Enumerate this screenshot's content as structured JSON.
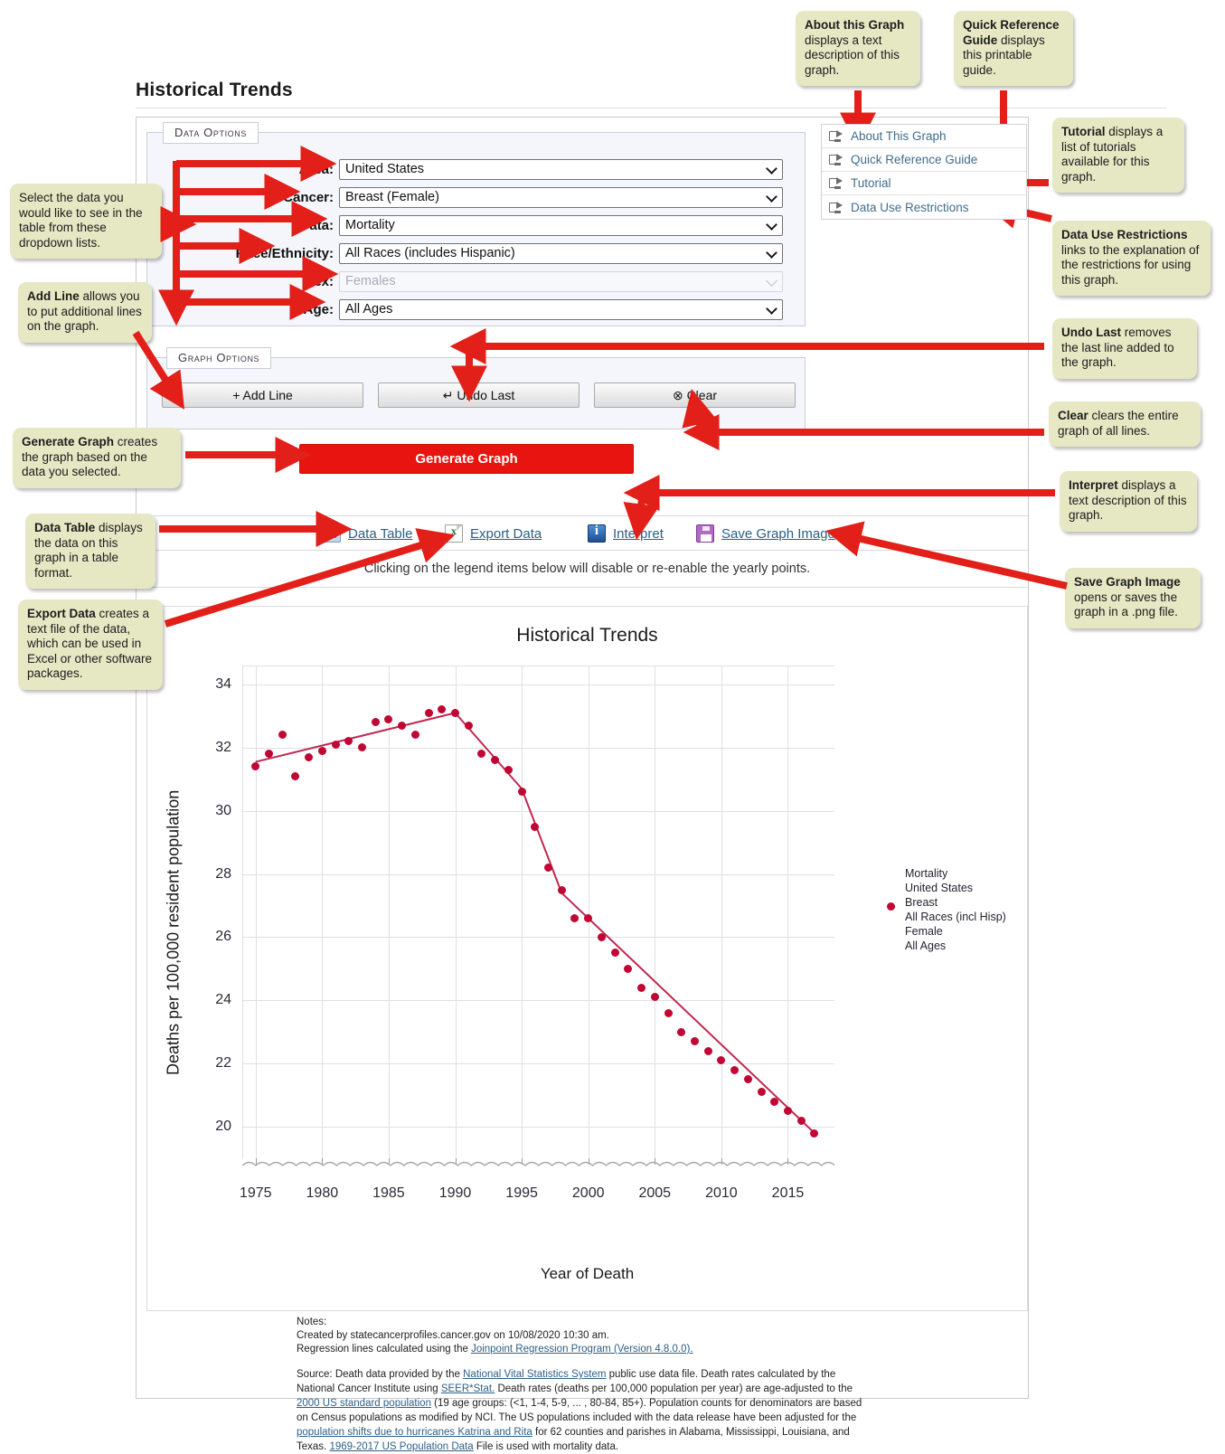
{
  "page": {
    "title": "Historical Trends"
  },
  "data_options": {
    "legend": "Data Options",
    "fields": [
      {
        "label": "Area:",
        "value": "United States",
        "name": "area",
        "disabled": false
      },
      {
        "label": "Cancer:",
        "value": "Breast (Female)",
        "name": "cancer",
        "disabled": false
      },
      {
        "label": "Data:",
        "value": "Mortality",
        "name": "data",
        "disabled": false
      },
      {
        "label": "Race/Ethnicity:",
        "value": "All Races (includes Hispanic)",
        "name": "race",
        "disabled": false
      },
      {
        "label": "Sex:",
        "value": "Females",
        "name": "sex",
        "disabled": true
      },
      {
        "label": "Age:",
        "value": "All Ages",
        "name": "age",
        "disabled": false
      }
    ]
  },
  "graph_options": {
    "legend": "Graph Options",
    "add_line": "+ Add Line",
    "undo_last": "↵ Undo Last",
    "clear": "⊗ Clear",
    "generate": "Generate Graph"
  },
  "side_links": [
    {
      "label": "About This Graph",
      "icon": "external-link-icon"
    },
    {
      "label": "Quick Reference Guide",
      "icon": "external-link-icon"
    },
    {
      "label": "Tutorial",
      "icon": "external-link-icon"
    },
    {
      "label": "Data Use Restrictions",
      "icon": "external-link-icon"
    }
  ],
  "toolbar": {
    "data_table": "Data Table",
    "export_data": "Export Data",
    "interpret": "Interpret",
    "save_graph_image": "Save Graph Image",
    "icons": [
      "data-table-icon",
      "excel-export-icon",
      "info-icon",
      "floppy-save-icon"
    ]
  },
  "hint": "Clicking on the legend items below will disable or re-enable the yearly points.",
  "legend": {
    "lines": [
      "Mortality",
      "United States",
      "Breast",
      "All Races (incl Hisp)",
      "Female",
      "All Ages"
    ]
  },
  "notes": {
    "heading": "Notes:",
    "created": "Created by statecancerprofiles.cancer.gov on 10/08/2020 10:30 am.",
    "regression_pre": "Regression lines calculated using the ",
    "regression_link": "Joinpoint Regression Program (Version 4.8.0.0).",
    "source_parts": [
      {
        "t": "Source: Death data provided by the ",
        "link": false
      },
      {
        "t": "National Vital Statistics System",
        "link": true
      },
      {
        "t": " public use data file. Death rates calculated by the National Cancer Institute using ",
        "link": false
      },
      {
        "t": "SEER*Stat.",
        "link": true
      },
      {
        "t": " Death rates (deaths per 100,000 population per year) are age-adjusted to the ",
        "link": false
      },
      {
        "t": "2000 US standard population",
        "link": true
      },
      {
        "t": " (19 age groups: (<1, 1-4, 5-9, ... , 80-84, 85+). Population counts for denominators are based on Census populations as modified by NCI. The US populations included with the data release have been adjusted for the ",
        "link": false
      },
      {
        "t": "population shifts due to hurricanes Katrina and Rita",
        "link": true
      },
      {
        "t": " for 62 counties and parishes in Alabama, Mississippi, Louisiana, and Texas. ",
        "link": false
      },
      {
        "t": "1969-2017 US Population Data",
        "link": true
      },
      {
        "t": " File is used with mortality data.",
        "link": false
      }
    ]
  },
  "callouts": [
    {
      "id": "about-this-graph",
      "bold": "About this Graph",
      "rest": " displays a text description of this graph."
    },
    {
      "id": "quick-reference",
      "bold": "Quick Reference Guide",
      "rest": " displays this printable guide."
    },
    {
      "id": "tutorial",
      "bold": "Tutorial",
      "rest": " displays a list of tutorials available for this graph."
    },
    {
      "id": "data-use",
      "bold": "Data Use Restrictions",
      "rest": " links to the explanation of the restrictions for using this graph."
    },
    {
      "id": "select-data",
      "bold": "",
      "rest": "Select the data you would like to see in the table from these dropdown lists."
    },
    {
      "id": "add-line",
      "bold": "Add Line",
      "rest": " allows you to put additional lines on the graph."
    },
    {
      "id": "generate-graph",
      "bold": "Generate Graph",
      "rest": " creates the graph based on the data you selected."
    },
    {
      "id": "data-table",
      "bold": "Data Table",
      "rest": " displays the data on this graph in a table format."
    },
    {
      "id": "export-data",
      "bold": "Export Data",
      "rest": " creates a text file of the data, which can be used in Excel or other software packages."
    },
    {
      "id": "undo-last",
      "bold": "Undo Last",
      "rest": " removes the last line added to the graph."
    },
    {
      "id": "clear",
      "bold": "Clear",
      "rest": " clears the entire graph of all lines."
    },
    {
      "id": "interpret",
      "bold": "Interpret",
      "rest": " displays a text description of this graph."
    },
    {
      "id": "save-graph-image",
      "bold": "Save Graph Image",
      "rest": " opens or saves the graph in a .png file."
    }
  ],
  "chart_data": {
    "type": "scatter",
    "title": "Historical Trends",
    "xlabel": "Year of Death",
    "ylabel": "Deaths per 100,000 resident population",
    "xlim": [
      1974,
      2018.5
    ],
    "ylim": [
      19.0,
      34.6
    ],
    "xticks": [
      1975,
      1980,
      1985,
      1990,
      1995,
      2000,
      2005,
      2010,
      2015
    ],
    "yticks": [
      20,
      22,
      24,
      26,
      28,
      30,
      32,
      34
    ],
    "grid": true,
    "legend_position": "right",
    "point_color": "#c00733",
    "line_color": "#c0294f",
    "series": [
      {
        "name": "Mortality, United States, Breast, All Races (incl Hisp), Female, All Ages",
        "x": [
          1975,
          1976,
          1977,
          1978,
          1979,
          1980,
          1981,
          1982,
          1983,
          1984,
          1985,
          1986,
          1987,
          1988,
          1989,
          1990,
          1991,
          1992,
          1993,
          1994,
          1995,
          1996,
          1997,
          1998,
          1999,
          2000,
          2001,
          2002,
          2003,
          2004,
          2005,
          2006,
          2007,
          2008,
          2009,
          2010,
          2011,
          2012,
          2013,
          2014,
          2015,
          2016,
          2017
        ],
        "values": [
          31.4,
          31.8,
          32.4,
          31.1,
          31.7,
          31.9,
          32.1,
          32.2,
          32.0,
          32.8,
          32.9,
          32.7,
          32.4,
          33.1,
          33.2,
          33.1,
          32.7,
          31.8,
          31.6,
          31.3,
          30.6,
          29.5,
          28.2,
          27.5,
          26.6,
          26.6,
          26.0,
          25.5,
          25.0,
          24.4,
          24.1,
          23.6,
          23.0,
          22.7,
          22.4,
          22.1,
          21.8,
          21.5,
          21.1,
          20.8,
          20.5,
          20.2,
          19.8
        ]
      }
    ],
    "regression_segments": [
      {
        "x": [
          1975,
          1990
        ],
        "y": [
          31.55,
          33.1
        ]
      },
      {
        "x": [
          1990,
          1995
        ],
        "y": [
          33.1,
          30.7
        ]
      },
      {
        "x": [
          1995,
          1998
        ],
        "y": [
          30.7,
          27.4
        ]
      },
      {
        "x": [
          1998,
          2017
        ],
        "y": [
          27.4,
          19.8
        ]
      }
    ]
  }
}
